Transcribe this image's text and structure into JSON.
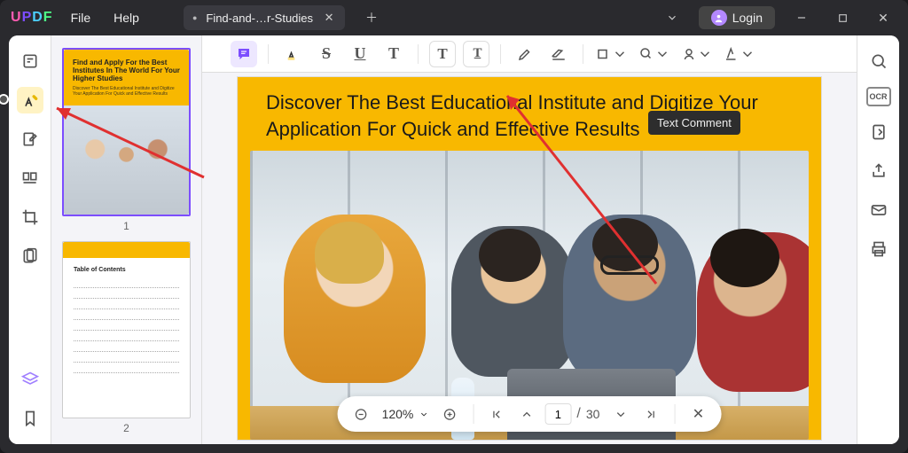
{
  "app_name": "UPDF",
  "menu": {
    "file": "File",
    "help": "Help"
  },
  "tab": {
    "title": "Find-and-…r-Studies"
  },
  "login": {
    "label": "Login"
  },
  "tooltip_text": "Text Comment",
  "heading": "Discover The Best Educational Institute and Digitize Your Application For Quick and Effective Results",
  "zoom_label": "120%",
  "page_current": "1",
  "page_total": "30",
  "thumb1": {
    "title": "Find and Apply For the Best Institutes In The World For Your Higher Studies",
    "subtitle": "Discover The Best Educational Institute and Digitize Your Application For Quick and Effective Results",
    "label": "1"
  },
  "thumb2": {
    "toc_title": "Table of Contents",
    "label": "2"
  },
  "ocr_label": "OCR"
}
